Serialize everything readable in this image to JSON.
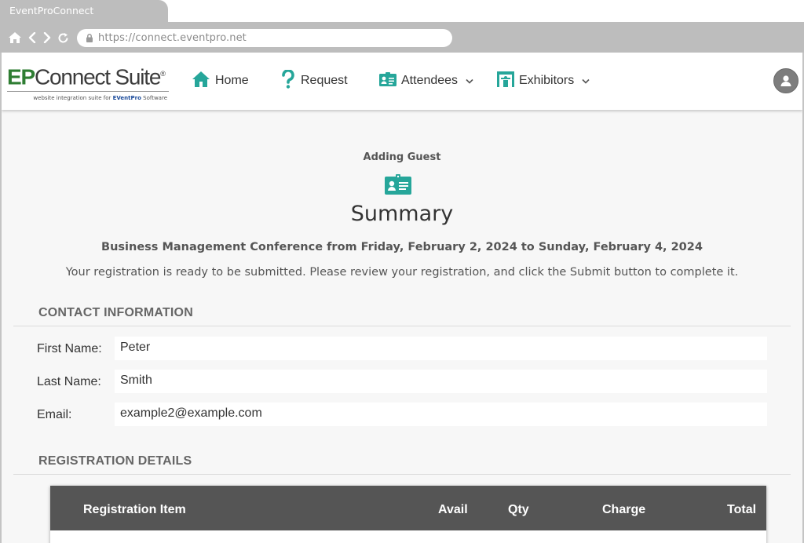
{
  "browser": {
    "tab_title": "EventProConnect",
    "url": "https://connect.eventpro.net"
  },
  "header": {
    "logo": {
      "brand_ep": "EP",
      "brand_rest": "Connect Suite",
      "registered": "®",
      "tagline_prefix": "website integration suite for",
      "tagline_brand": "EVentPro",
      "tagline_suffix": "Software"
    },
    "nav": [
      {
        "label": "Home",
        "icon": "house-icon"
      },
      {
        "label": "Request",
        "icon": "question-mark-icon"
      },
      {
        "label": "Attendees",
        "icon": "id-card-icon",
        "has_dropdown": true
      },
      {
        "label": "Exhibitors",
        "icon": "booth-icon",
        "has_dropdown": true
      }
    ],
    "avatar_icon": "user-avatar-icon"
  },
  "main": {
    "subtitle": "Adding Guest",
    "title": "Summary",
    "event_line": "Business Management Conference from Friday, February 2, 2024 to Sunday, February 4, 2024",
    "instructions": "Your registration is ready to be submitted. Please review your registration, and click the Submit button to complete it."
  },
  "contact": {
    "heading": "CONTACT INFORMATION",
    "fields": [
      {
        "label": "First Name:",
        "value": "Peter"
      },
      {
        "label": "Last Name:",
        "value": "Smith"
      },
      {
        "label": "Email:",
        "value": "example2@example.com"
      }
    ]
  },
  "registration": {
    "heading": "REGISTRATION DETAILS",
    "columns": [
      "Registration Item",
      "Avail",
      "Qty",
      "Charge",
      "Total"
    ]
  },
  "colors": {
    "accent_teal": "#26a69a",
    "brand_green": "#2e7d32",
    "table_header": "#555555"
  }
}
